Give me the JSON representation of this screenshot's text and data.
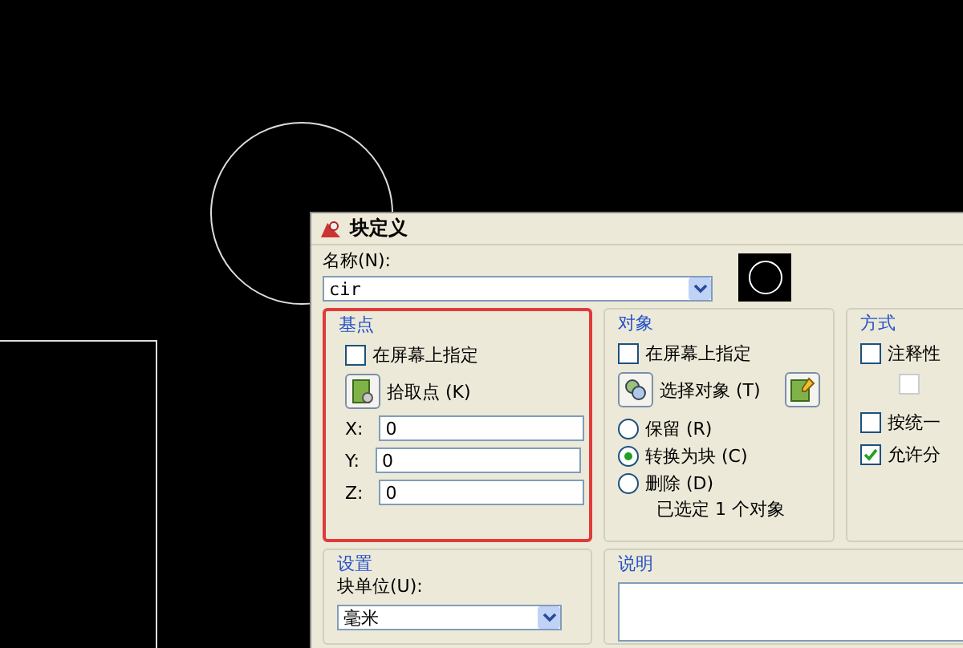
{
  "dialog": {
    "title": "块定义",
    "name": {
      "label": "名称(N):",
      "value": "cir"
    },
    "base_point": {
      "title": "基点",
      "specify_on_screen": {
        "label": "在屏幕上指定",
        "checked": false
      },
      "pick_point": "拾取点 (K)",
      "coords": [
        {
          "label": "X:",
          "value": "0"
        },
        {
          "label": "Y:",
          "value": "0"
        },
        {
          "label": "Z:",
          "value": "0"
        }
      ],
      "highlighted": true
    },
    "objects": {
      "title": "对象",
      "specify_on_screen": {
        "label": "在屏幕上指定",
        "checked": false
      },
      "select_objects": "选择对象 (T)",
      "options": [
        {
          "label": "保留 (R)",
          "selected": false
        },
        {
          "label": "转换为块 (C)",
          "selected": true
        },
        {
          "label": "删除 (D)",
          "selected": false
        }
      ],
      "status": "已选定 1 个对象"
    },
    "behavior": {
      "title": "方式",
      "checks": [
        {
          "label": "注释性",
          "checked": false,
          "disabled": false
        },
        {
          "checked": false,
          "disabled": true
        },
        {
          "label": "按统一",
          "checked": false,
          "disabled": false
        },
        {
          "label": "允许分",
          "checked": true,
          "disabled": false
        }
      ]
    },
    "settings": {
      "title": "设置",
      "unit_label": "块单位(U):",
      "unit_value": "毫米"
    },
    "description": {
      "title": "说明"
    }
  }
}
